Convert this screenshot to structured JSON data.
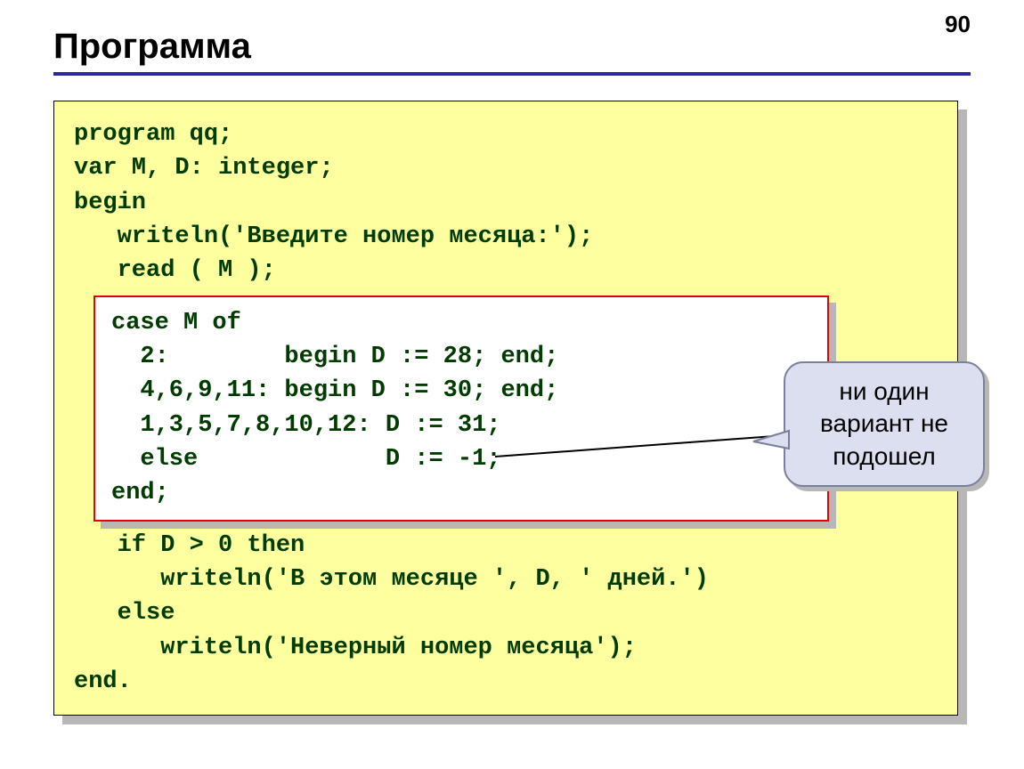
{
  "page_number": "90",
  "title": "Программа",
  "code": {
    "l1": "program qq;",
    "l2": "var M, D: integer;",
    "l3": "begin",
    "l4": "   writeln('Введите номер месяца:');",
    "l5": "   read ( M );",
    "l12": "   if D > 0 then",
    "l13": "      writeln('В этом месяце ', D, ' дней.')",
    "l14": "   else",
    "l15": "      writeln('Неверный номер месяца');",
    "l16": "end."
  },
  "inner_code": {
    "l6": "case M of",
    "l7": "  2:        begin D := 28; end;",
    "l8": "  4,6,9,11: begin D := 30; end;",
    "l9": "  1,3,5,7,8,10,12: D := 31;",
    "l10": "  else             D := -1;",
    "l11": "end;"
  },
  "callout": {
    "line1": "ни один",
    "line2": "вариант не",
    "line3": "подошел"
  }
}
